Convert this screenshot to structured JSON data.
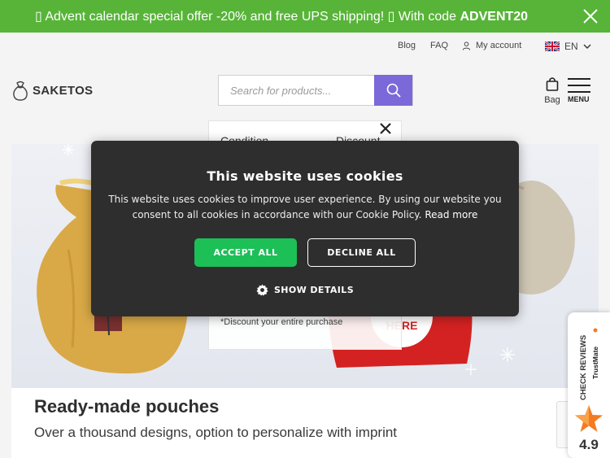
{
  "announcement": {
    "text": "▯ Advent calendar special offer -20% and free UPS shipping! ▯ With code ",
    "code": "ADVENT20"
  },
  "utility_nav": {
    "blog": "Blog",
    "faq": "FAQ",
    "account": "My account",
    "language": "EN"
  },
  "header": {
    "logo": "SAKETOS",
    "search_placeholder": "Search for products...",
    "bag_label": "Bag",
    "menu_label": "MENU"
  },
  "discount_popup": {
    "condition_header": "Condition",
    "discount_header": "Discount",
    "note": "*Discount your entire purchase"
  },
  "cookie_modal": {
    "title": "This website uses cookies",
    "text": "This website uses cookies to improve user experience. By using our website you consent to all cookies in accordance with our Cookie Policy.",
    "read_more": "Read more",
    "accept_label": "ACCEPT ALL",
    "decline_label": "DECLINE ALL",
    "details_label": "SHOW DETAILS"
  },
  "hero": {
    "title": "Ready-made pouches",
    "subtitle": "Over a thousand designs, option to personalize with imprint",
    "tag_text": "HERE"
  },
  "trust_widget": {
    "label": "CHECK REVIEWS",
    "brand": "TrustMate",
    "score": "4.9"
  },
  "colors": {
    "announcement_bg": "#57b438",
    "search_button": "#7b68d9",
    "modal_bg": "#2e2e2e",
    "accept_button": "#1dbf57",
    "trust_star": "#f47b20"
  }
}
